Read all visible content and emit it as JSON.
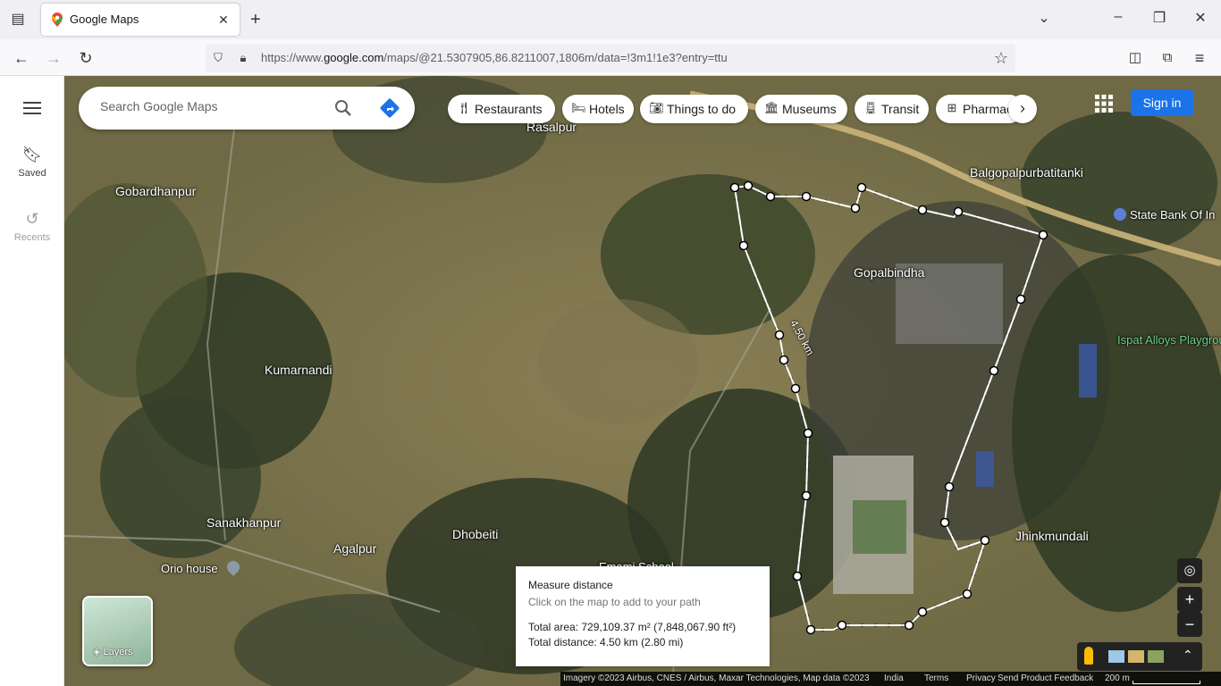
{
  "browser": {
    "tab_title": "Google Maps",
    "url_prefix": "https://www.",
    "url_domain": "google.com",
    "url_rest": "/maps/@21.5307905,86.8211007,1806m/data=!3m1!1e3?entry=ttu"
  },
  "sidebar": {
    "saved_label": "Saved",
    "recents_label": "Recents"
  },
  "search": {
    "placeholder": "Search Google Maps"
  },
  "chips": [
    {
      "label": "Restaurants",
      "icon": "fork-knife-icon"
    },
    {
      "label": "Hotels",
      "icon": "bed-icon"
    },
    {
      "label": "Things to do",
      "icon": "camera-icon"
    },
    {
      "label": "Museums",
      "icon": "museum-icon"
    },
    {
      "label": "Transit",
      "icon": "train-icon"
    },
    {
      "label": "Pharmac",
      "icon": "pharmacy-icon"
    }
  ],
  "signin_label": "Sign in",
  "places": {
    "rasalpur": "Rasalpur",
    "gobardhanpur": "Gobardhanpur",
    "balgopal": "Balgopalpurbatitanki",
    "sbi": "State Bank Of In",
    "gopalbindha": "Gopalbindha",
    "ispat": "Ispat Alloys Playgrour",
    "kumarnandi": "Kumarnandi",
    "sanakhanpur": "Sanakhanpur",
    "agalpur": "Agalpur",
    "dhobeiti": "Dhobeiti",
    "orio": "Orio house",
    "emami": "Emami School",
    "jhinkmundali": "Jhinkmundali",
    "path_label": "4.50 km"
  },
  "measure": {
    "title": "Measure distance",
    "hint": "Click on the map to add to your path",
    "area": "Total area: 729,109.37 m² (7,848,067.90 ft²)",
    "distance": "Total distance: 4.50 km (2.80 mi)"
  },
  "layers_label": "Layers",
  "footer": {
    "imagery": "Imagery ©2023 Airbus, CNES / Airbus, Maxar Technologies, Map data ©2023",
    "india": "India",
    "terms": "Terms",
    "privacy": "Privacy",
    "feedback": "Send Product Feedback",
    "scale": "200 m"
  },
  "colors": {
    "accent": "#1a73e8",
    "terrain": "#6f6a45"
  }
}
